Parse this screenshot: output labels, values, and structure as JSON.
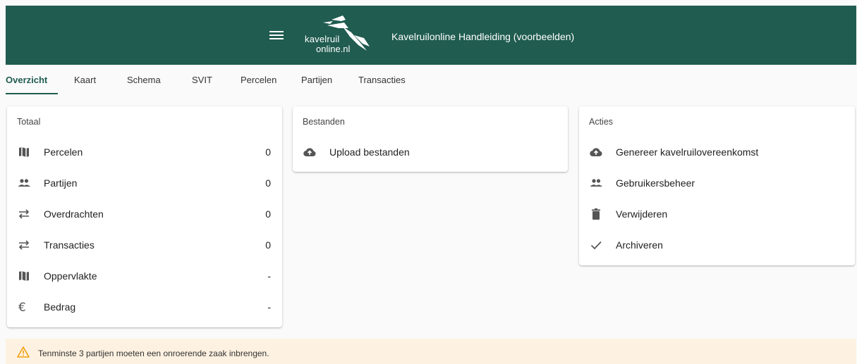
{
  "header": {
    "logo_line1": "kavelruil",
    "logo_line2": "online.nl",
    "title": "Kavelruilonline Handleiding (voorbeelden)",
    "menu_icon": "hamburger-menu-icon",
    "brand_color": "#205c50"
  },
  "tabs": [
    {
      "label": "Overzicht",
      "active": true
    },
    {
      "label": "Kaart"
    },
    {
      "label": "Schema"
    },
    {
      "label": "SVIT"
    },
    {
      "label": "Percelen"
    },
    {
      "label": "Partijen"
    },
    {
      "label": "Transacties"
    }
  ],
  "totaal": {
    "title": "Totaal",
    "rows": [
      {
        "icon": "map-icon",
        "label": "Percelen",
        "value": "0"
      },
      {
        "icon": "people-icon",
        "label": "Partijen",
        "value": "0"
      },
      {
        "icon": "swap-icon",
        "label": "Overdrachten",
        "value": "0"
      },
      {
        "icon": "swap-icon",
        "label": "Transacties",
        "value": "0"
      },
      {
        "icon": "map-icon",
        "label": "Oppervlakte",
        "value": "-"
      },
      {
        "icon": "euro-icon",
        "label": "Bedrag",
        "value": "-"
      }
    ]
  },
  "bestanden": {
    "title": "Bestanden",
    "rows": [
      {
        "icon": "cloud-upload-icon",
        "label": "Upload bestanden"
      }
    ]
  },
  "acties": {
    "title": "Acties",
    "rows": [
      {
        "icon": "cloud-upload-icon",
        "label": "Genereer kavelruilovereenkomst"
      },
      {
        "icon": "people-icon",
        "label": "Gebruikersbeheer"
      },
      {
        "icon": "trash-icon",
        "label": "Verwijderen"
      },
      {
        "icon": "check-icon",
        "label": "Archiveren"
      }
    ]
  },
  "warning": {
    "icon": "warning-icon",
    "text": "Tenminste 3 partijen moeten een onroerende zaak inbrengen.",
    "color": "#fdf1e1"
  }
}
